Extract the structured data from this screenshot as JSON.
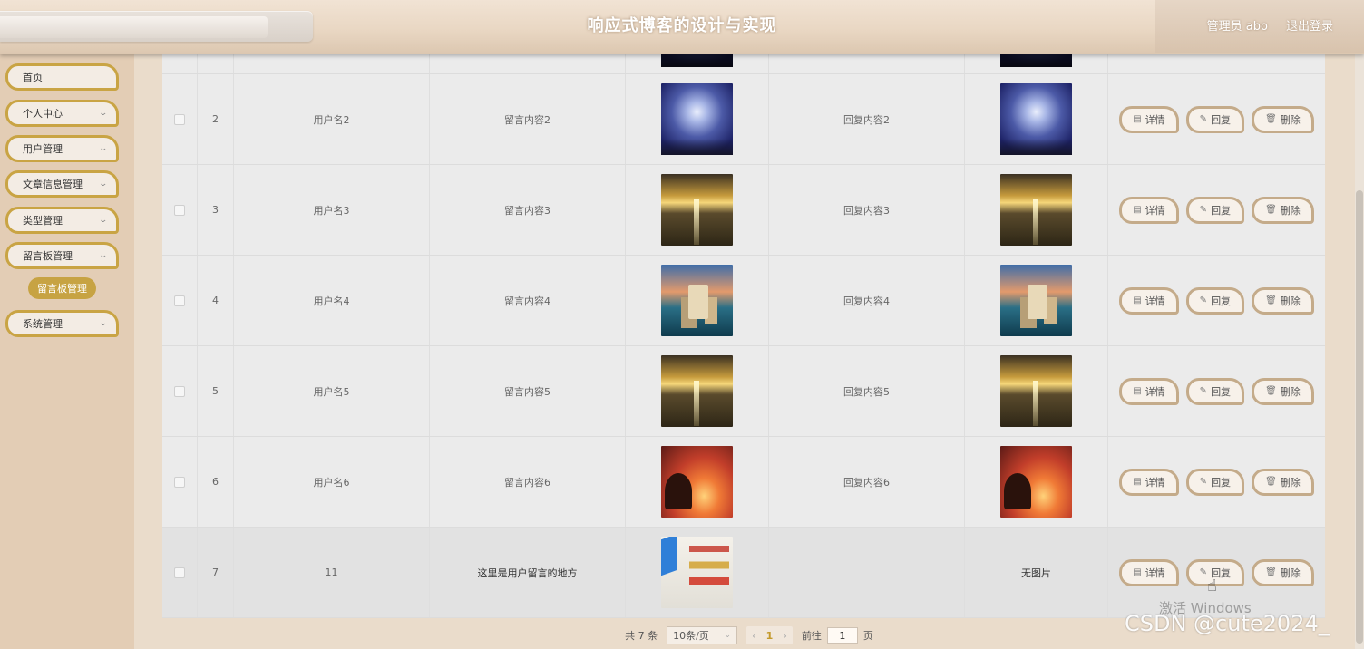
{
  "header": {
    "title": "响应式博客的设计与实现",
    "admin_label": "管理员 abo",
    "logout_label": "退出登录"
  },
  "sidebar": {
    "items": [
      {
        "label": "首页"
      },
      {
        "label": "个人中心"
      },
      {
        "label": "用户管理"
      },
      {
        "label": "文章信息管理"
      },
      {
        "label": "类型管理"
      },
      {
        "label": "留言板管理"
      },
      {
        "label": "系统管理"
      }
    ],
    "active_sub": "留言板管理"
  },
  "table": {
    "rows": [
      {
        "index": "2",
        "user": "用户名2",
        "message": "留言内容2",
        "reply": "回复内容2",
        "image": "night-sky",
        "reply_image": "night-sky"
      },
      {
        "index": "3",
        "user": "用户名3",
        "message": "留言内容3",
        "reply": "回复内容3",
        "image": "sunset-beach",
        "reply_image": "sunset-beach"
      },
      {
        "index": "4",
        "user": "用户名4",
        "message": "留言内容4",
        "reply": "回复内容4",
        "image": "castle-lake",
        "reply_image": "castle-lake"
      },
      {
        "index": "5",
        "user": "用户名5",
        "message": "留言内容5",
        "reply": "回复内容5",
        "image": "sunset-beach",
        "reply_image": "sunset-beach"
      },
      {
        "index": "6",
        "user": "用户名6",
        "message": "留言内容6",
        "reply": "回复内容6",
        "image": "fire-sunset",
        "reply_image": "fire-sunset"
      },
      {
        "index": "7",
        "user": "11",
        "message": "这里是用户留言的地方",
        "reply": "",
        "image": "book-cover",
        "reply_image_text": "无图片"
      }
    ],
    "actions": {
      "detail": "详情",
      "reply": "回复",
      "delete": "删除"
    }
  },
  "pagination": {
    "total": "共 7 条",
    "page_size": "10条/页",
    "current_page": "1",
    "goto_label": "前往",
    "goto_value": "1",
    "page_unit": "页"
  },
  "overlay": {
    "activate": "激活 Windows",
    "csdn": "CSDN @cute2024_"
  }
}
